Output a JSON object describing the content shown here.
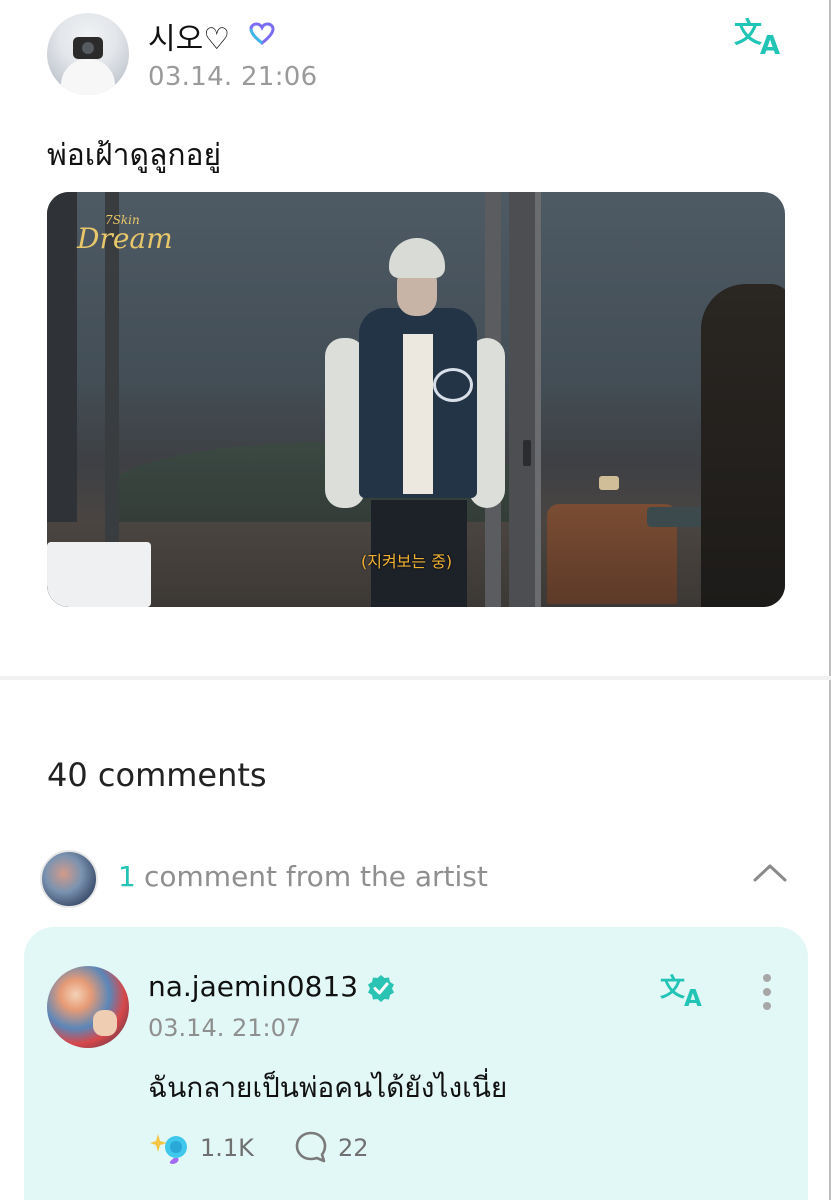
{
  "post": {
    "author": {
      "name": "시오♡",
      "badge_icon": "heart-outline-icon",
      "badge_color": "#7b6cf6",
      "avatar_icon": "user-avatar"
    },
    "timestamp": "03.14. 21:06",
    "translate_icon": "translate-icon",
    "text": "พ่อเฝ้าดูลูกอยู่",
    "image": {
      "logo_text": "Dream",
      "logo_small_text": "7Skin",
      "subtitle": "(지켜보는 중)"
    }
  },
  "comments": {
    "count_label": "40 comments",
    "artist_section": {
      "count": "1",
      "label": "comment from the artist",
      "collapse_icon": "chevron-up-icon"
    },
    "artist_comment": {
      "author": "na.jaemin0813",
      "verified_icon": "verified-badge-icon",
      "timestamp": "03.14. 21:07",
      "text": "ฉันกลายเป็นพ่อคนได้ยังไงเนี่ย",
      "translate_icon": "translate-icon",
      "more_icon": "more-vertical-icon",
      "likes_icon": "sparkle-heart-icon",
      "likes": "1.1K",
      "reply_icon": "comment-bubble-icon",
      "replies": "22"
    }
  },
  "colors": {
    "accent": "#21c4b5",
    "card_bg": "#e2f8f6",
    "muted_text": "#8f8f8f"
  }
}
